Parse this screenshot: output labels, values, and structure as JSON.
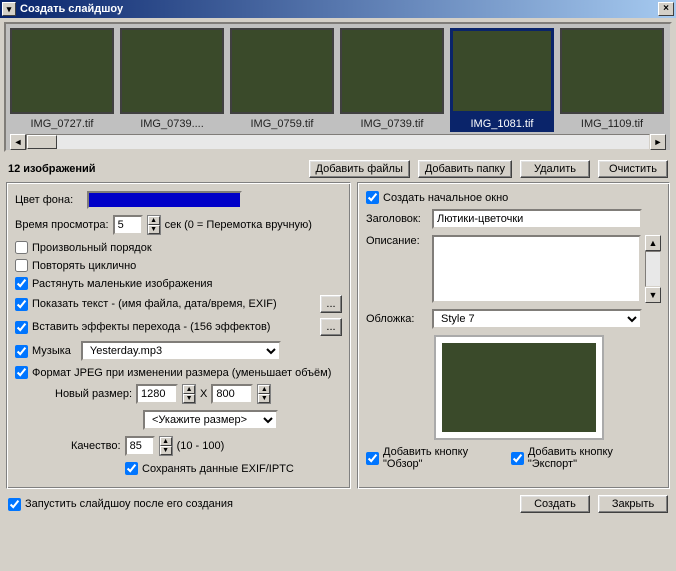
{
  "window": {
    "title": "Создать слайдшоу",
    "close_glyph": "×"
  },
  "thumbnails": {
    "items": [
      {
        "name": "IMG_0727.tif"
      },
      {
        "name": "IMG_0739...."
      },
      {
        "name": "IMG_0759.tif"
      },
      {
        "name": "IMG_0739.tif"
      },
      {
        "name": "IMG_1081.tif"
      },
      {
        "name": "IMG_1109.tif"
      }
    ],
    "selected_index": 4,
    "scroll_left": "◄",
    "scroll_right": "►"
  },
  "count_label": "12 изображений",
  "toolbar": {
    "add_files": "Добавить файлы",
    "add_folder": "Добавить папку",
    "delete": "Удалить",
    "clear": "Очистить"
  },
  "left": {
    "bgcolor_label": "Цвет фона:",
    "bgcolor_value": "#0000c8",
    "viewtime_label": "Время просмотра:",
    "viewtime_value": "5",
    "viewtime_unit": "сек (0 = Перемотка вручную)",
    "random_order": "Произвольный порядок",
    "loop": "Повторять циклично",
    "stretch": "Растянуть маленькие изображения",
    "show_text": "Показать текст - (имя файла, дата/время, EXIF)",
    "show_text_more": "...",
    "transitions": "Вставить эффекты перехода - (156 эффектов)",
    "transitions_more": "...",
    "music": "Музыка",
    "music_value": "Yesterday.mp3",
    "jpeg_format": "Формат JPEG при изменении размера (уменьшает объём)",
    "newsize_label": "Новый размер:",
    "newsize_w": "1280",
    "newsize_sep": "X",
    "newsize_h": "800",
    "size_hint": "<Укажите размер>",
    "quality_label": "Качество:",
    "quality_value": "85",
    "quality_range": "(10 - 100)",
    "save_exif": "Сохранять данные EXIF/IPTC"
  },
  "right": {
    "start_window": "Создать начальное окно",
    "title_label": "Заголовок:",
    "title_value": "Лютики-цветочки",
    "desc_label": "Описание:",
    "desc_value": "",
    "cover_label": "Обложка:",
    "cover_value": "Style 7",
    "add_browse": "Добавить кнопку \"Обзор\"",
    "add_export": "Добавить кнопку \"Экспорт\""
  },
  "footer": {
    "run_after": "Запустить слайдшоу после его создания",
    "create": "Создать",
    "close": "Закрыть"
  }
}
